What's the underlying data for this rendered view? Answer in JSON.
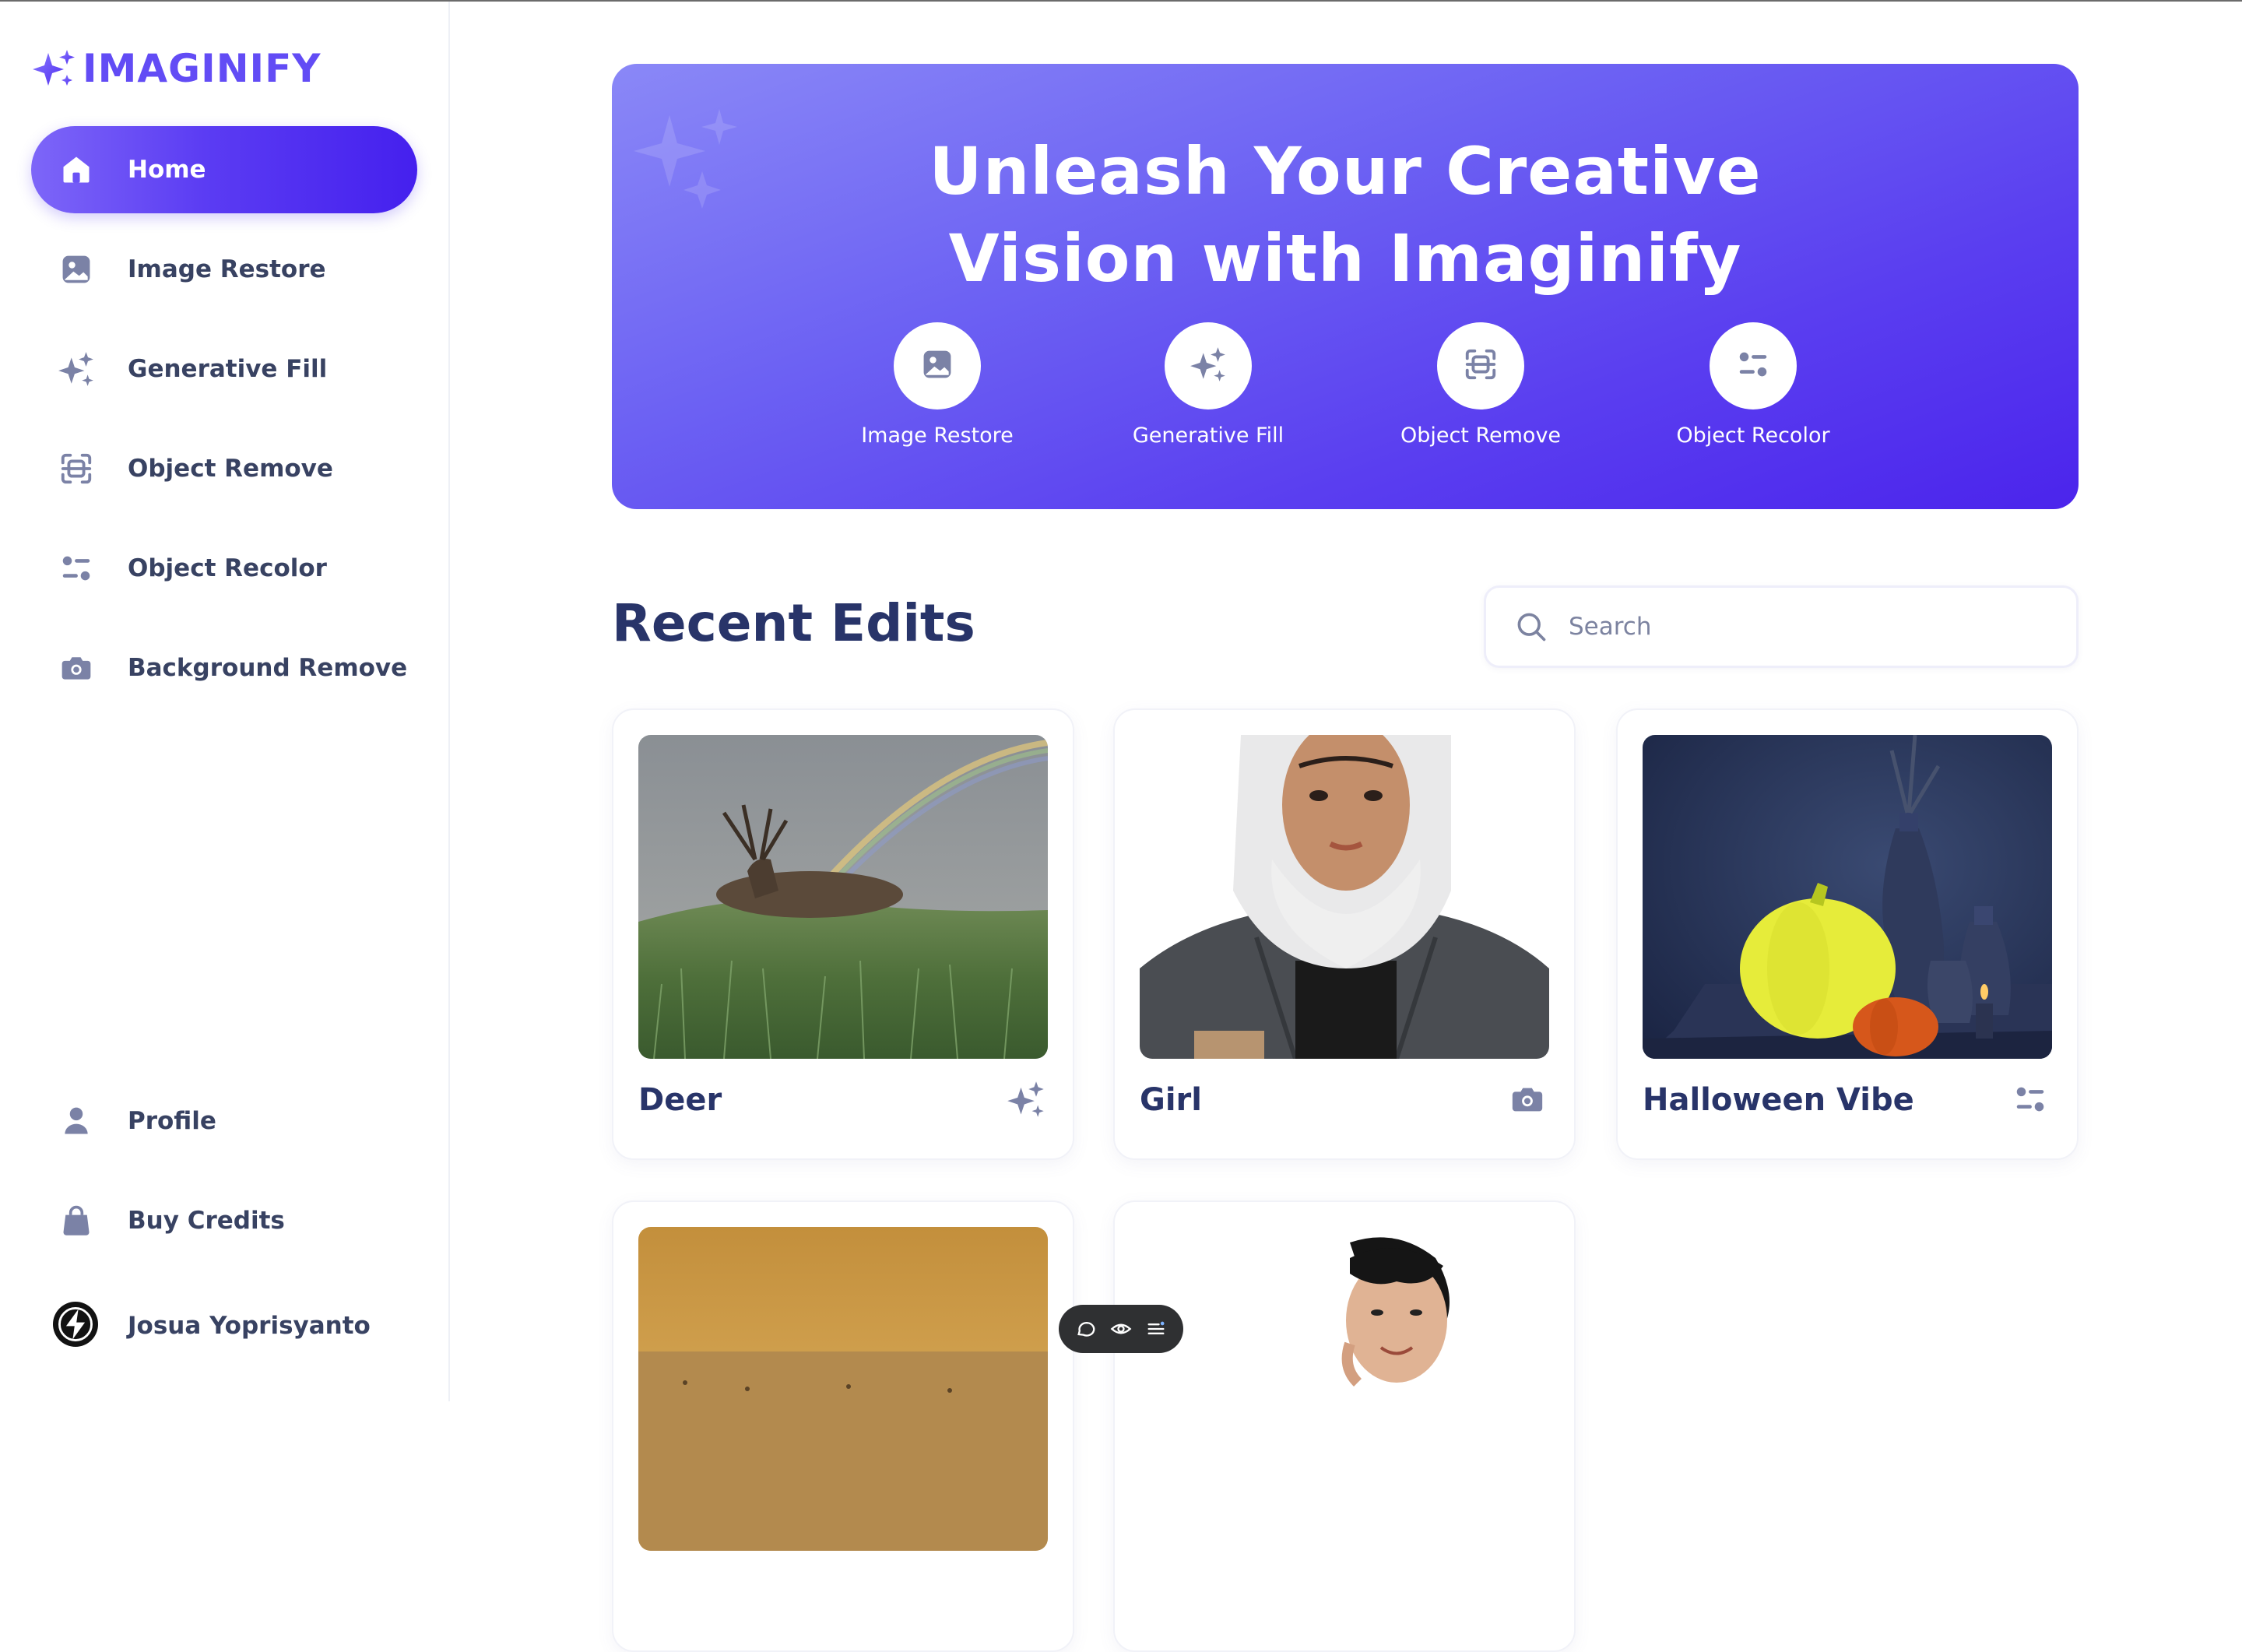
{
  "app": {
    "name": "IMAGINIFY"
  },
  "sidebar": {
    "nav": [
      {
        "label": "Home",
        "icon": "home-icon",
        "active": true
      },
      {
        "label": "Image Restore",
        "icon": "image-icon"
      },
      {
        "label": "Generative Fill",
        "icon": "stars-icon"
      },
      {
        "label": "Object Remove",
        "icon": "scan-icon"
      },
      {
        "label": "Object Recolor",
        "icon": "filter-icon"
      },
      {
        "label": "Background Remove",
        "icon": "camera-icon"
      }
    ],
    "bottom": [
      {
        "label": "Profile",
        "icon": "user-icon"
      },
      {
        "label": "Buy Credits",
        "icon": "bag-icon"
      }
    ],
    "user": {
      "name": "Josua Yoprisyanto",
      "icon": "avatar"
    }
  },
  "hero": {
    "title_line1": "Unleash Your Creative",
    "title_line2": "Vision with Imaginify",
    "tools": [
      {
        "label": "Image Restore",
        "icon": "image-icon"
      },
      {
        "label": "Generative Fill",
        "icon": "stars-icon"
      },
      {
        "label": "Object Remove",
        "icon": "scan-icon"
      },
      {
        "label": "Object Recolor",
        "icon": "filter-icon"
      }
    ]
  },
  "recent": {
    "title": "Recent Edits",
    "search_placeholder": "Search",
    "items": [
      {
        "title": "Deer",
        "type_icon": "stars-icon"
      },
      {
        "title": "Girl",
        "type_icon": "camera-icon"
      },
      {
        "title": "Halloween Vibe",
        "type_icon": "filter-icon"
      },
      {
        "title": "",
        "type_icon": ""
      },
      {
        "title": "",
        "type_icon": ""
      }
    ]
  },
  "toolbar": {
    "icons": [
      "chat-icon",
      "eye-icon",
      "menu-icon"
    ]
  },
  "colors": {
    "accent": "#5b3cf3",
    "heading": "#283469",
    "text": "#384262",
    "icon": "#7b82a6"
  }
}
